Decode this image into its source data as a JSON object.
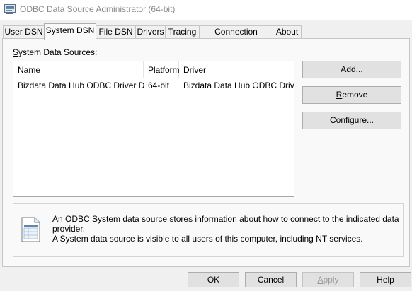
{
  "window": {
    "title": "ODBC Data Source Administrator (64-bit)",
    "icon": "odbc-admin-icon"
  },
  "tabs": [
    {
      "label": "User DSN",
      "active": false
    },
    {
      "label": "System DSN",
      "active": true
    },
    {
      "label": "File DSN",
      "active": false
    },
    {
      "label": "Drivers",
      "active": false
    },
    {
      "label": "Tracing",
      "active": false
    },
    {
      "label": "Connection Pooling",
      "active": false
    },
    {
      "label": "About",
      "active": false
    }
  ],
  "system_dsn": {
    "section_label_accel": "S",
    "section_label_rest": "ystem Data Sources:",
    "columns": [
      "Name",
      "Platform",
      "Driver"
    ],
    "rows": [
      {
        "name": "Bizdata Data Hub ODBC Driver DSN",
        "platform": "64-bit",
        "driver": "Bizdata Data Hub ODBC Driver"
      }
    ],
    "buttons": {
      "add": {
        "pre": "A",
        "accel": "d",
        "post": "d..."
      },
      "remove": {
        "pre": "",
        "accel": "R",
        "post": "emove"
      },
      "configure": {
        "pre": "",
        "accel": "C",
        "post": "onfigure..."
      }
    },
    "info_icon": "data-source-document-icon",
    "info_text_line1": "An ODBC System data source stores information about how to connect to the indicated data provider.",
    "info_text_line2": "A System data source is visible to all users of this computer, including NT services."
  },
  "footer": {
    "ok": "OK",
    "cancel": "Cancel",
    "apply_accel": "A",
    "apply_rest": "pply",
    "apply_enabled": false,
    "help": "Help"
  }
}
